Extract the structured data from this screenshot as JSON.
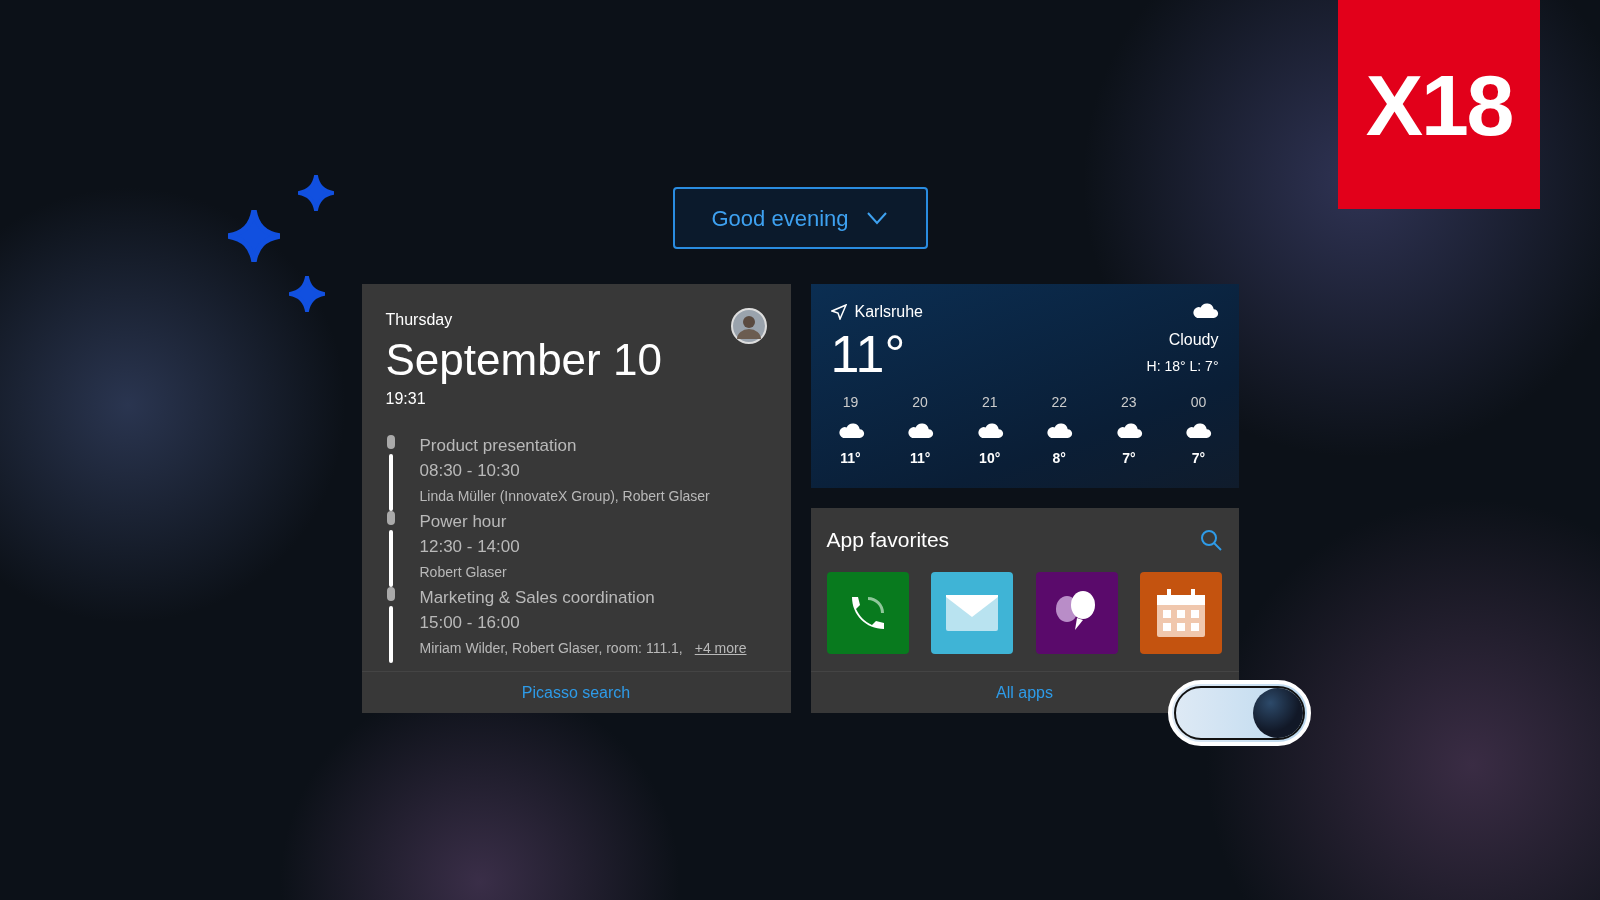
{
  "logo": {
    "text": "X18"
  },
  "greeting": {
    "label": "Good evening",
    "expanded": false
  },
  "calendar": {
    "weekday": "Thursday",
    "date": "September 10",
    "time": "19:31",
    "events": [
      {
        "title": "Product presentation",
        "time": "08:30 - 10:30",
        "attendees": "Linda Müller (InnovateX Group), Robert Glaser"
      },
      {
        "title": "Power hour",
        "time": "12:30 - 14:00",
        "attendees": "Robert Glaser"
      },
      {
        "title": "Marketing & Sales coordination",
        "time": "15:00 - 16:00",
        "attendees": "Miriam Wilder, Robert Glaser, room: 111.1,",
        "more": "+4 more"
      }
    ],
    "footer_link": "Picasso search"
  },
  "weather": {
    "location": "Karlsruhe",
    "temperature": "11°",
    "condition": "Cloudy",
    "high_low": "H: 18° L: 7°",
    "hourly": [
      {
        "hour": "19",
        "temp": "11°"
      },
      {
        "hour": "20",
        "temp": "11°"
      },
      {
        "hour": "21",
        "temp": "10°"
      },
      {
        "hour": "22",
        "temp": "8°"
      },
      {
        "hour": "23",
        "temp": "7°"
      },
      {
        "hour": "00",
        "temp": "7°"
      }
    ]
  },
  "apps": {
    "title": "App favorites",
    "items": [
      {
        "kind": "phone",
        "color": "#087a1e"
      },
      {
        "kind": "mail",
        "color": "#3fb4d6"
      },
      {
        "kind": "chat",
        "color": "#5a0a6b"
      },
      {
        "kind": "calendar",
        "color": "#c4530f"
      }
    ],
    "footer_link": "All apps"
  },
  "toggle": {
    "on": true
  }
}
